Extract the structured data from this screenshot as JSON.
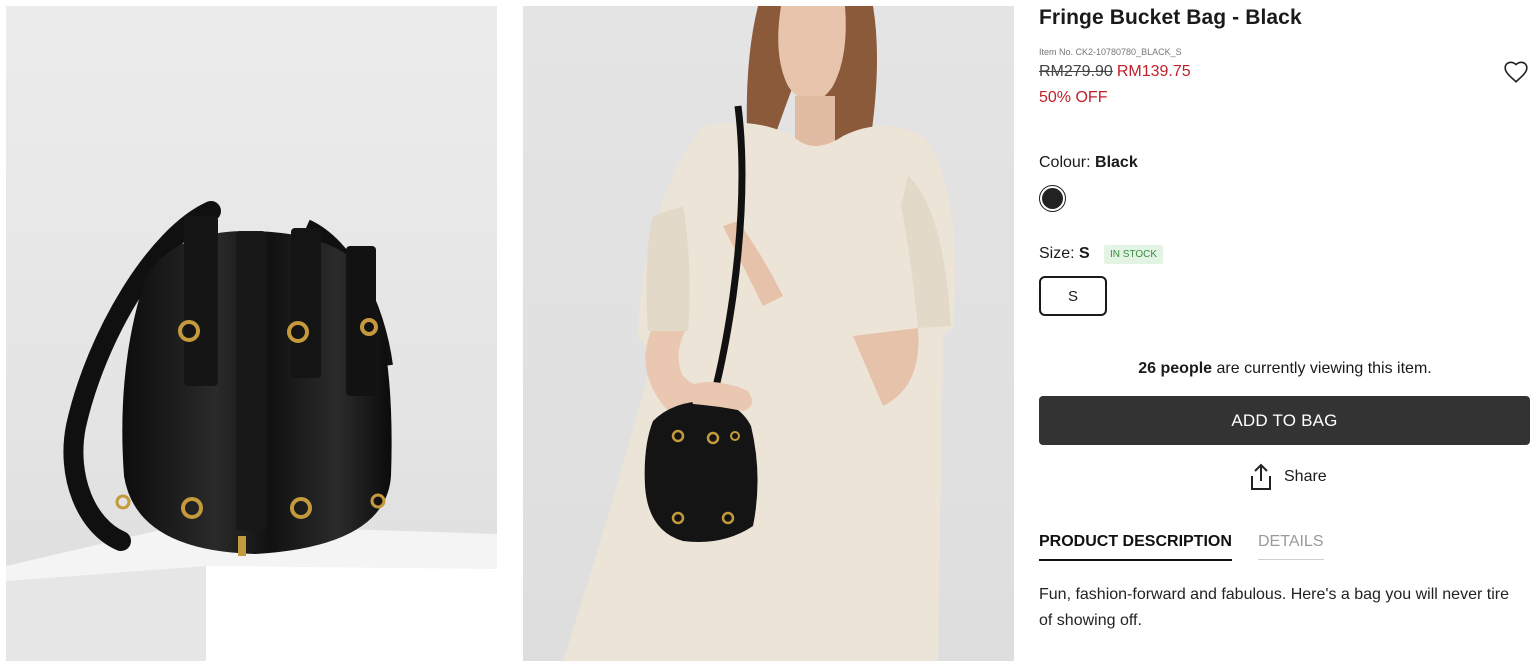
{
  "product": {
    "title": "Fringe Bucket Bag - Black",
    "item_no": "Item No. CK2-10780780_BLACK_S",
    "price_original": "RM279.90",
    "price_sale": "RM139.75",
    "discount": "50% OFF"
  },
  "colour": {
    "label": "Colour:",
    "value": "Black",
    "swatch_hex": "#222222"
  },
  "size": {
    "label": "Size:",
    "value": "S",
    "stock_badge": "IN STOCK",
    "options": [
      "S"
    ]
  },
  "viewing": {
    "count": "26 people",
    "text": " are currently viewing this item."
  },
  "actions": {
    "add_to_bag": "ADD TO BAG",
    "share": "Share"
  },
  "tabs": [
    {
      "label": "PRODUCT DESCRIPTION",
      "active": true
    },
    {
      "label": "DETAILS",
      "active": false
    }
  ],
  "description": "Fun, fashion-forward and fabulous. Here's a bag you will never tire of showing off.",
  "icons": {
    "wishlist": "heart-icon",
    "share": "share-icon"
  },
  "colors": {
    "sale_red": "#c0202a",
    "button_dark": "#333333",
    "stock_bg": "#e3f4e4",
    "stock_text": "#3b8b42"
  }
}
